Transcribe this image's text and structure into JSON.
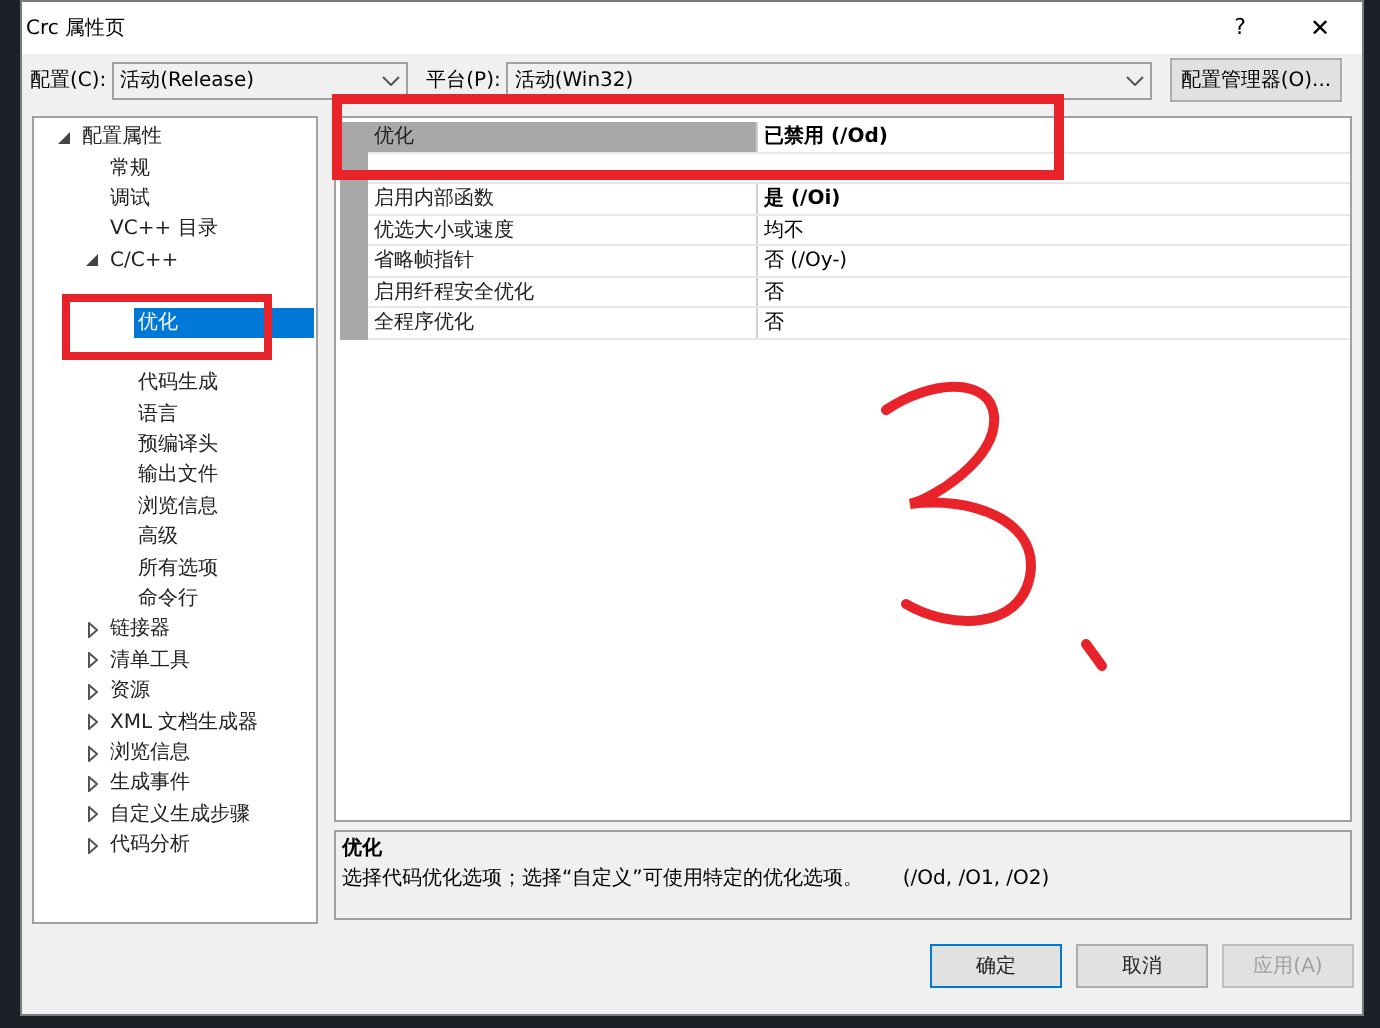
{
  "window": {
    "title": "Crc 属性页",
    "help": "?",
    "close": "✕"
  },
  "config": {
    "label": "配置(C):",
    "value": "活动(Release)"
  },
  "platform": {
    "label": "平台(P):",
    "value": "活动(Win32)"
  },
  "config_manager": "配置管理器(O)...",
  "tree": [
    {
      "label": "配置属性",
      "expanded": true,
      "selected": false,
      "children": [
        {
          "label": "常规",
          "selected": false
        },
        {
          "label": "调试",
          "selected": false
        },
        {
          "label": "VC++ 目录",
          "selected": false
        },
        {
          "label": "C/C++",
          "expanded": true,
          "selected": false,
          "children": [
            {
              "label": "优化",
              "selected": true
            },
            {
              "label": "代码生成",
              "selected": false
            },
            {
              "label": "语言",
              "selected": false
            },
            {
              "label": "预编译头",
              "selected": false
            },
            {
              "label": "输出文件",
              "selected": false
            },
            {
              "label": "浏览信息",
              "selected": false
            },
            {
              "label": "高级",
              "selected": false
            },
            {
              "label": "所有选项",
              "selected": false
            },
            {
              "label": "命令行",
              "selected": false
            }
          ]
        },
        {
          "label": "链接器",
          "expanded": false,
          "selected": false
        },
        {
          "label": "清单工具",
          "expanded": false,
          "selected": false
        },
        {
          "label": "资源",
          "expanded": false,
          "selected": false
        },
        {
          "label": "XML 文档生成器",
          "expanded": false,
          "selected": false
        },
        {
          "label": "浏览信息",
          "expanded": false,
          "selected": false
        },
        {
          "label": "生成事件",
          "expanded": false,
          "selected": false
        },
        {
          "label": "自定义生成步骤",
          "expanded": false,
          "selected": false
        },
        {
          "label": "代码分析",
          "expanded": false,
          "selected": false
        }
      ]
    }
  ],
  "properties": [
    {
      "name": "优化",
      "value": "已禁用 (/Od)",
      "bold": true,
      "selected": true
    },
    {
      "kind": "covered"
    },
    {
      "name": "启用内部函数",
      "value": "是 (/Oi)",
      "bold": true,
      "selected": false
    },
    {
      "name": "优选大小或速度",
      "value": "均不",
      "bold": false,
      "selected": false
    },
    {
      "name": "省略帧指针",
      "value": "否 (/Oy-)",
      "bold": false,
      "selected": false
    },
    {
      "name": "启用纤程安全优化",
      "value": "否",
      "bold": false,
      "selected": false
    },
    {
      "name": "全程序优化",
      "value": "否",
      "bold": false,
      "selected": false
    }
  ],
  "description": {
    "title": "优化",
    "text": "选择代码优化选项；选择“自定义”可使用特定的优化选项。",
    "switches": "(/Od, /O1, /O2)"
  },
  "buttons": [
    {
      "label": "确定",
      "kind": "default",
      "disabled": false
    },
    {
      "label": "取消",
      "kind": "normal",
      "disabled": false
    },
    {
      "label": "应用(A)",
      "kind": "normal",
      "disabled": true
    }
  ]
}
